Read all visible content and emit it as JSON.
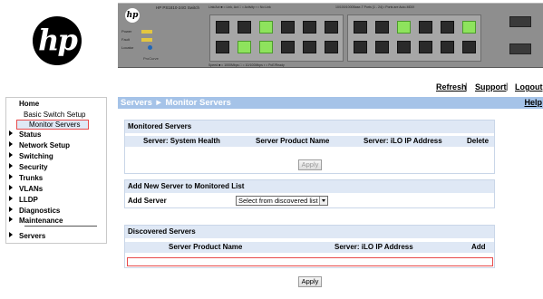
{
  "logo": {
    "text": "hp"
  },
  "switch": {
    "logo_text": "hp",
    "model": "HP PS1810-24G Switch",
    "legend_top_left": "Link/Act  ■ = Link, Act  □ = Activity  ▪ = No Link",
    "legend_top_mid": "10/100/1000Base-T Ports (1 - 24) • Ports are Auto-MDIX",
    "legend_bottom": "Speed  ■ = 1000Mbps  □ = 10/100Mbps  ▪ = PoE/Ready",
    "leds": [
      {
        "label": "Power"
      },
      {
        "label": "Fault"
      },
      {
        "label": "Locator"
      }
    ],
    "brand": "ProCurve",
    "active_ports": [
      4,
      5,
      6,
      17,
      23
    ]
  },
  "toplinks": {
    "refresh": "Refresh",
    "support": "Support",
    "logout": "Logout",
    "separator": "|"
  },
  "sidebar": {
    "items": [
      {
        "label": "Home",
        "arrow": false
      },
      {
        "label": "Basic Switch Setup",
        "arrow": false
      },
      {
        "label": "Monitor Servers",
        "arrow": false,
        "selected": true
      },
      {
        "label": "Status",
        "arrow": true
      },
      {
        "label": "Network Setup",
        "arrow": true
      },
      {
        "label": "Switching",
        "arrow": true
      },
      {
        "label": "Security",
        "arrow": true
      },
      {
        "label": "Trunks",
        "arrow": true
      },
      {
        "label": "VLANs",
        "arrow": true
      },
      {
        "label": "LLDP",
        "arrow": true
      },
      {
        "label": "Diagnostics",
        "arrow": true
      },
      {
        "label": "Maintenance",
        "arrow": true
      },
      {
        "label": "Servers",
        "arrow": true
      }
    ]
  },
  "main": {
    "title": "Servers ► Monitor Servers",
    "help": "Help",
    "monitored": {
      "heading": "Monitored Servers",
      "columns": [
        "Server: System Health",
        "Server Product Name",
        "Server: iLO IP Address",
        "Delete"
      ],
      "apply_label": "Apply"
    },
    "add_new": {
      "heading": "Add New Server to Monitored List",
      "add_label": "Add Server",
      "select_value": "Select from discovered list"
    },
    "discovered": {
      "heading": "Discovered Servers",
      "columns": [
        "Server Product Name",
        "Server: iLO IP Address",
        "Add"
      ],
      "apply_label": "Apply"
    }
  }
}
